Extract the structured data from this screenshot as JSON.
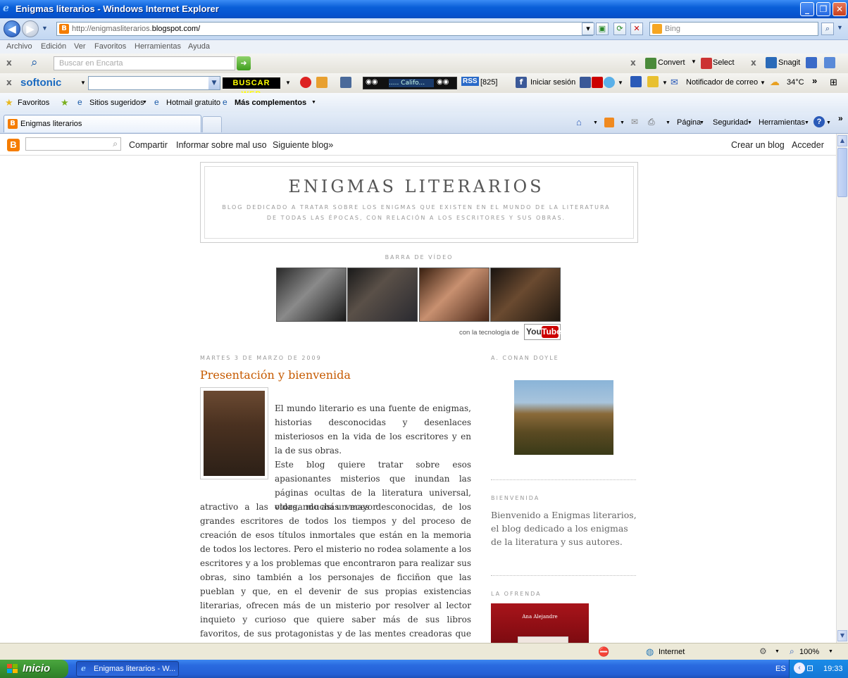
{
  "window": {
    "title": "Enigmas literarios - Windows Internet Explorer",
    "minimize_glyph": "_",
    "restore_glyph": "❐",
    "close_glyph": "✕"
  },
  "address_bar": {
    "url_prefix": "http://enigmasliterarios.",
    "url_domain": "blogspot.com/",
    "search_placeholder": "Bing"
  },
  "menu": [
    "Archivo",
    "Edición",
    "Ver",
    "Favoritos",
    "Herramientas",
    "Ayuda"
  ],
  "toolbar1": {
    "encarta_placeholder": "Buscar en Encarta",
    "convert_label": "Convert",
    "select_label": "Select",
    "snagit_label": "Snagit"
  },
  "toolbar2": {
    "softonic_label": "softonic",
    "buscaweb_label": "BUSCAR WEB",
    "player_display": "..... Califo...",
    "rss_count": "[825]",
    "login_label": "Iniciar sesión",
    "mail_notifier_label": "Notificador de correo",
    "weather_temp": "34°C"
  },
  "favorites_bar": {
    "favorites_label": "Favoritos",
    "suggested_label": "Sitios sugeridos",
    "hotmail_label": "Hotmail gratuito",
    "more_label": "Más complementos"
  },
  "tab": {
    "label": "Enigmas literarios"
  },
  "command_bar": {
    "page_label": "Página",
    "security_label": "Seguridad",
    "tools_label": "Herramientas"
  },
  "blogger_nav": {
    "share": "Compartir",
    "report": "Informar sobre mal uso",
    "next_blog": "Siguiente blog»",
    "create_blog": "Crear un blog",
    "login": "Acceder"
  },
  "blog": {
    "title": "ENIGMAS LITERARIOS",
    "description_line1": "BLOG DEDICADO A TRATAR SOBRE LOS ENIGMAS QUE EXISTEN EN EL MUNDO DE LA LITERATURA",
    "description_line2": "DE TODAS LAS ÉPOCAS, CON RELACIÓN A LOS ESCRITORES Y SUS OBRAS.",
    "video_bar_label": "BARRA DE VÍDEO",
    "powered_by": "con la tecnología de",
    "youtube_you": "You",
    "youtube_tube": "Tube"
  },
  "post": {
    "date": "MARTES 3 DE MARZO DE 2009",
    "title": "Presentación y bienvenida",
    "para1": "El mundo literario es una fuente de enigmas, historias desconocidas y desenlaces misteriosos en la vida de los escritores y en la de sus obras.",
    "para2_side": "Este blog quiere tratar sobre esos apasionantes misterios que inundan las páginas ocultas de la literatura universal, otorgando así un mayor",
    "para2_full": "atractivo a las vidas, muchas veces desconocidas, de los grandes escritores de todos los tiempos y del proceso de creación de esos títulos inmortales que están en la memoria de todos los lectores. Pero el misterio no rodea solamente a los escritores y a los problemas que encontraron para realizar sus obras, sino también a los personajes de ficciñon que las pueblan y que, en el devenir de sus propias existencias literarias, ofrecen más de un misterio por resolver al lector inquieto y curioso que quiere saber más de sus libros favoritos, de sus protagonistas y de las mentes creadoras que los escribieron."
  },
  "sidebar": {
    "conan_label": "A. CONAN DOYLE",
    "welcome_label": "BIENVENIDA",
    "welcome_text": "Bienvenido a Enigmas literarios, el blog dedicado a los enigmas de la literatura y sus autores.",
    "ofrenda_label": "LA OFRENDA",
    "book_author": "Ana Alejandre"
  },
  "status_bar": {
    "zone": "Internet",
    "zoom": "100%"
  },
  "taskbar": {
    "start_label": "Inicio",
    "task_label": "Enigmas literarios - W...",
    "lang": "ES",
    "clock": "19:33"
  }
}
